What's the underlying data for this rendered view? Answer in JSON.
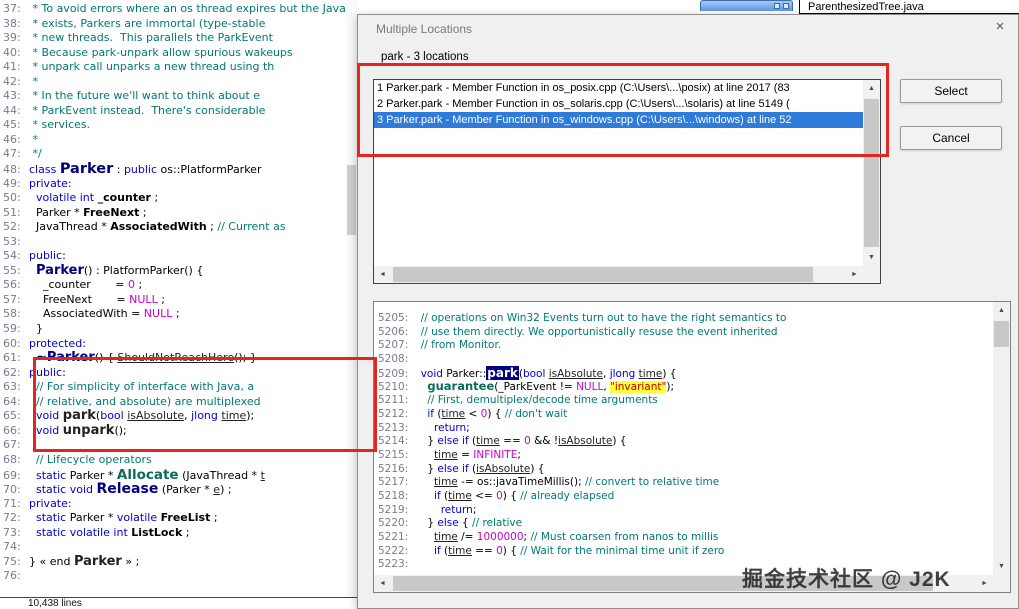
{
  "colors": {
    "selection_blue": "#2e7bd9",
    "annotation_red": "#e3261f",
    "keyword_blue": "#0000d6",
    "comment_teal": "#007878",
    "literal_magenta": "#cc00cc",
    "highlight_navy": "#000080",
    "string_highlight_yellow": "#ffff3c",
    "string_red": "#c00000"
  },
  "top_bar": {
    "file_label": "ParenthesizedTree.java"
  },
  "left_editor": {
    "status_fragment": "10,438 lines",
    "lines": [
      {
        "n": "37:",
        "s": [
          [
            "c",
            " * To avoid errors where an os thread expires but the JavaThread still"
          ]
        ]
      },
      {
        "n": "38:",
        "s": [
          [
            "c",
            " * exists, Parkers are immortal (type-stable"
          ]
        ]
      },
      {
        "n": "39:",
        "s": [
          [
            "c",
            " * new threads.  This parallels the ParkEvent"
          ]
        ]
      },
      {
        "n": "40:",
        "s": [
          [
            "c",
            " * Because park-unpark allow spurious wakeups"
          ]
        ]
      },
      {
        "n": "41:",
        "s": [
          [
            "c",
            " * unpark call unparks a new thread using th"
          ]
        ]
      },
      {
        "n": "42:",
        "s": [
          [
            "c",
            " *"
          ]
        ]
      },
      {
        "n": "43:",
        "s": [
          [
            "c",
            " * In the future we'll want to think about e"
          ]
        ]
      },
      {
        "n": "44:",
        "s": [
          [
            "c",
            " * ParkEvent instead.  There's considerable"
          ]
        ]
      },
      {
        "n": "45:",
        "s": [
          [
            "c",
            " * services."
          ]
        ]
      },
      {
        "n": "46:",
        "s": [
          [
            "c",
            " *"
          ]
        ]
      },
      {
        "n": "47:",
        "s": [
          [
            "c",
            " */"
          ]
        ]
      },
      {
        "n": "48:",
        "s": [
          [
            "k",
            "class "
          ],
          [
            "C",
            "Parker"
          ],
          [
            "p",
            " : "
          ],
          [
            "k",
            "public"
          ],
          [
            "p",
            " os::PlatformParker"
          ]
        ]
      },
      {
        "n": "49:",
        "s": [
          [
            "k",
            "private"
          ],
          [
            "p",
            ":"
          ]
        ]
      },
      {
        "n": "50:",
        "s": [
          [
            "p",
            "  "
          ],
          [
            "k",
            "volatile int "
          ],
          [
            "B",
            "_counter"
          ],
          [
            "p",
            " ;"
          ]
        ]
      },
      {
        "n": "51:",
        "s": [
          [
            "p",
            "  Parker * "
          ],
          [
            "B",
            "FreeNext"
          ],
          [
            "p",
            " ;"
          ]
        ]
      },
      {
        "n": "52:",
        "s": [
          [
            "p",
            "  JavaThread * "
          ],
          [
            "B",
            "AssociatedWith"
          ],
          [
            "p",
            " ; "
          ],
          [
            "c",
            "// Current as"
          ]
        ]
      },
      {
        "n": "53:",
        "s": []
      },
      {
        "n": "54:",
        "s": [
          [
            "k",
            "public"
          ],
          [
            "p",
            ":"
          ]
        ]
      },
      {
        "n": "55:",
        "s": [
          [
            "p",
            "  "
          ],
          [
            "F2",
            "Parker"
          ],
          [
            "p",
            "() : PlatformParker() {"
          ]
        ]
      },
      {
        "n": "56:",
        "s": [
          [
            "p",
            "    _counter       = "
          ],
          [
            "m",
            "0"
          ],
          [
            "p",
            " ;"
          ]
        ]
      },
      {
        "n": "57:",
        "s": [
          [
            "p",
            "    FreeNext       = "
          ],
          [
            "m",
            "NULL"
          ],
          [
            "p",
            " ;"
          ]
        ]
      },
      {
        "n": "58:",
        "s": [
          [
            "p",
            "    AssociatedWith = "
          ],
          [
            "m",
            "NULL"
          ],
          [
            "p",
            " ;"
          ]
        ]
      },
      {
        "n": "59:",
        "s": [
          [
            "p",
            "  }"
          ]
        ]
      },
      {
        "n": "60:",
        "s": [
          [
            "k",
            "protected"
          ],
          [
            "p",
            ":"
          ]
        ]
      },
      {
        "n": "61:",
        "s": [
          [
            "p",
            "  "
          ],
          [
            "F2",
            "~Parker"
          ],
          [
            "p",
            "() { "
          ],
          [
            "u",
            "ShouldNotReachHere"
          ],
          [
            "p",
            "(); }"
          ]
        ]
      },
      {
        "n": "62:",
        "s": [
          [
            "k",
            "public"
          ],
          [
            "p",
            ":"
          ]
        ]
      },
      {
        "n": "63:",
        "s": [
          [
            "p",
            "  "
          ],
          [
            "c",
            "// For simplicity of interface with Java, a"
          ]
        ]
      },
      {
        "n": "64:",
        "s": [
          [
            "p",
            "  "
          ],
          [
            "c",
            "// relative, and absolute) are multiplexed"
          ]
        ]
      },
      {
        "n": "65:",
        "s": [
          [
            "p",
            "  "
          ],
          [
            "k",
            "void "
          ],
          [
            "F",
            "park"
          ],
          [
            "p",
            "("
          ],
          [
            "k",
            "bool "
          ],
          [
            "u",
            "isAbsolute"
          ],
          [
            "p",
            ", "
          ],
          [
            "k",
            "jlong "
          ],
          [
            "u",
            "time"
          ],
          [
            "p",
            ");"
          ]
        ]
      },
      {
        "n": "66:",
        "s": [
          [
            "p",
            "  "
          ],
          [
            "k",
            "void "
          ],
          [
            "F",
            "unpark"
          ],
          [
            "p",
            "();"
          ]
        ]
      },
      {
        "n": "67:",
        "s": []
      },
      {
        "n": "68:",
        "s": [
          [
            "p",
            "  "
          ],
          [
            "c",
            "// Lifecycle operators"
          ]
        ]
      },
      {
        "n": "69:",
        "s": [
          [
            "p",
            "  "
          ],
          [
            "k",
            "static "
          ],
          [
            "p",
            "Parker * "
          ],
          [
            "G",
            "Allocate"
          ],
          [
            "p",
            " (JavaThread * "
          ],
          [
            "u",
            "t"
          ]
        ]
      },
      {
        "n": "70:",
        "s": [
          [
            "p",
            "  "
          ],
          [
            "k",
            "static void "
          ],
          [
            "C2",
            "Release"
          ],
          [
            "p",
            " (Parker * "
          ],
          [
            "u",
            "e"
          ],
          [
            "p",
            ") ;"
          ]
        ]
      },
      {
        "n": "71:",
        "s": [
          [
            "k",
            "private"
          ],
          [
            "p",
            ":"
          ]
        ]
      },
      {
        "n": "72:",
        "s": [
          [
            "p",
            "  "
          ],
          [
            "k",
            "static "
          ],
          [
            "p",
            "Parker * "
          ],
          [
            "k",
            "volatile "
          ],
          [
            "B",
            "FreeList"
          ],
          [
            "p",
            " ;"
          ]
        ]
      },
      {
        "n": "73:",
        "s": [
          [
            "p",
            "  "
          ],
          [
            "k",
            "static volatile int "
          ],
          [
            "B",
            "ListLock"
          ],
          [
            "p",
            " ;"
          ]
        ]
      },
      {
        "n": "74:",
        "s": []
      },
      {
        "n": "75:",
        "s": [
          [
            "p",
            "} « end "
          ],
          [
            "F",
            "Parker"
          ],
          [
            "p",
            " » ;"
          ]
        ]
      },
      {
        "n": "76:",
        "s": []
      }
    ]
  },
  "dialog": {
    "title": "Multiple Locations",
    "close_glyph": "×",
    "list_label": "park - 3 locations",
    "select_button": "Select",
    "cancel_button": "Cancel",
    "locations": [
      {
        "text": "1 Parker.park - Member Function in os_posix.cpp (C:\\Users\\...\\posix) at line 2017 (83",
        "selected": false
      },
      {
        "text": "2 Parker.park - Member Function in os_solaris.cpp (C:\\Users\\...\\solaris) at line 5149 (",
        "selected": false
      },
      {
        "text": "3 Parker.park - Member Function in os_windows.cpp (C:\\Users\\...\\windows) at line 52",
        "selected": true
      }
    ],
    "scroll_glyphs": {
      "up": "▲",
      "down": "▼",
      "left": "◄",
      "right": "►"
    },
    "preview": {
      "lines": [
        {
          "n": "5205:",
          "s": [
            [
              "p",
              "  "
            ],
            [
              "c",
              "// operations on Win32 Events turn out to have the right semantics to"
            ]
          ]
        },
        {
          "n": "5206:",
          "s": [
            [
              "p",
              "  "
            ],
            [
              "c",
              "// use them directly. We opportunistically resuse the event inherited"
            ]
          ]
        },
        {
          "n": "5207:",
          "s": [
            [
              "p",
              "  "
            ],
            [
              "c",
              "// from Monitor."
            ]
          ]
        },
        {
          "n": "5208:",
          "s": []
        },
        {
          "n": "5209:",
          "s": [
            [
              "p",
              "  "
            ],
            [
              "k",
              "void "
            ],
            [
              "p",
              "Parker::"
            ],
            [
              "S",
              "park"
            ],
            [
              "p",
              "("
            ],
            [
              "k",
              "bool "
            ],
            [
              "u",
              "isAbsolute"
            ],
            [
              "p",
              ", "
            ],
            [
              "k",
              "jlong "
            ],
            [
              "u",
              "time"
            ],
            [
              "p",
              ") {"
            ]
          ]
        },
        {
          "n": "5210:",
          "s": [
            [
              "p",
              "    "
            ],
            [
              "G",
              "guarantee"
            ],
            [
              "p",
              "(_ParkEvent != "
            ],
            [
              "m",
              "NULL"
            ],
            [
              "p",
              ", "
            ],
            [
              "Y",
              "\"invariant\""
            ],
            [
              "p",
              ");"
            ]
          ]
        },
        {
          "n": "5211:",
          "s": [
            [
              "p",
              "    "
            ],
            [
              "c",
              "// First, demultiplex/decode time arguments"
            ]
          ]
        },
        {
          "n": "5212:",
          "s": [
            [
              "p",
              "    "
            ],
            [
              "k",
              "if"
            ],
            [
              "p",
              " ("
            ],
            [
              "u",
              "time"
            ],
            [
              "p",
              " < "
            ],
            [
              "m",
              "0"
            ],
            [
              "p",
              ") { "
            ],
            [
              "c",
              "// don't wait"
            ]
          ]
        },
        {
          "n": "5213:",
          "s": [
            [
              "p",
              "      "
            ],
            [
              "k",
              "return"
            ],
            [
              "p",
              ";"
            ]
          ]
        },
        {
          "n": "5214:",
          "s": [
            [
              "p",
              "    } "
            ],
            [
              "k",
              "else if"
            ],
            [
              "p",
              " ("
            ],
            [
              "u",
              "time"
            ],
            [
              "p",
              " == "
            ],
            [
              "m",
              "0"
            ],
            [
              "p",
              " && !"
            ],
            [
              "u",
              "isAbsolute"
            ],
            [
              "p",
              ") {"
            ]
          ]
        },
        {
          "n": "5215:",
          "s": [
            [
              "p",
              "      "
            ],
            [
              "u",
              "time"
            ],
            [
              "p",
              " = "
            ],
            [
              "m",
              "INFINITE"
            ],
            [
              "p",
              ";"
            ]
          ]
        },
        {
          "n": "5216:",
          "s": [
            [
              "p",
              "    } "
            ],
            [
              "k",
              "else if"
            ],
            [
              "p",
              " ("
            ],
            [
              "u",
              "isAbsolute"
            ],
            [
              "p",
              ") {"
            ]
          ]
        },
        {
          "n": "5217:",
          "s": [
            [
              "p",
              "      "
            ],
            [
              "u",
              "time"
            ],
            [
              "p",
              " -= os::javaTimeMillis(); "
            ],
            [
              "c",
              "// convert to relative time"
            ]
          ]
        },
        {
          "n": "5218:",
          "s": [
            [
              "p",
              "      "
            ],
            [
              "k",
              "if"
            ],
            [
              "p",
              " ("
            ],
            [
              "u",
              "time"
            ],
            [
              "p",
              " <= "
            ],
            [
              "m",
              "0"
            ],
            [
              "p",
              ") { "
            ],
            [
              "c",
              "// already elapsed"
            ]
          ]
        },
        {
          "n": "5219:",
          "s": [
            [
              "p",
              "        "
            ],
            [
              "k",
              "return"
            ],
            [
              "p",
              ";"
            ]
          ]
        },
        {
          "n": "5220:",
          "s": [
            [
              "p",
              "    } "
            ],
            [
              "k",
              "else"
            ],
            [
              "p",
              " { "
            ],
            [
              "c",
              "// relative"
            ]
          ]
        },
        {
          "n": "5221:",
          "s": [
            [
              "p",
              "      "
            ],
            [
              "u",
              "time"
            ],
            [
              "p",
              " /= "
            ],
            [
              "m",
              "1000000"
            ],
            [
              "p",
              "; "
            ],
            [
              "c",
              "// Must coarsen from nanos to millis"
            ]
          ]
        },
        {
          "n": "5222:",
          "s": [
            [
              "p",
              "      "
            ],
            [
              "k",
              "if"
            ],
            [
              "p",
              " ("
            ],
            [
              "u",
              "time"
            ],
            [
              "p",
              " == "
            ],
            [
              "m",
              "0"
            ],
            [
              "p",
              ") { "
            ],
            [
              "c",
              "// Wait for the minimal time unit if zero"
            ]
          ]
        },
        {
          "n": "5223:",
          "s": []
        }
      ]
    }
  },
  "watermark": "掘金技术社区 @ J2K"
}
